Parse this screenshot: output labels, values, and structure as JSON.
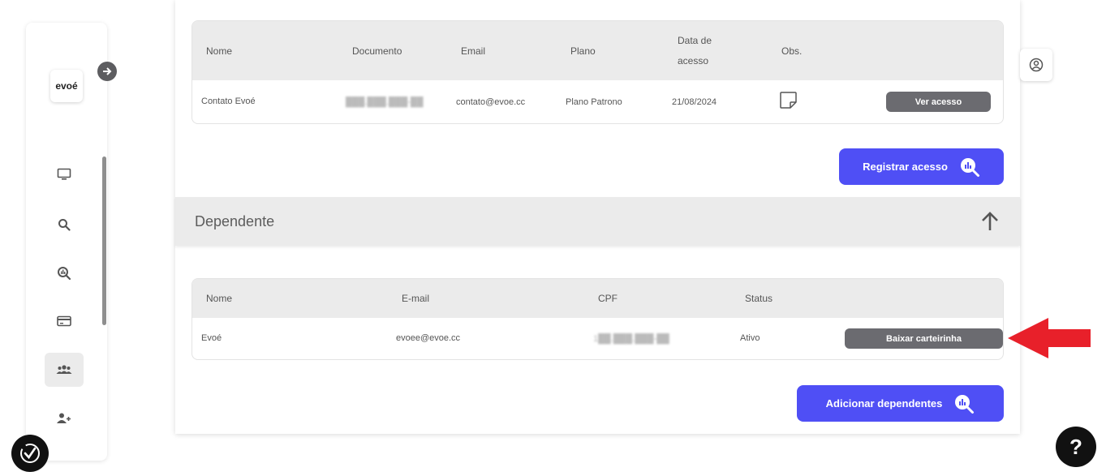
{
  "sidebar": {
    "logo_text": "evoé",
    "expand_icon": "arrow-right-circle-icon",
    "items": [
      {
        "icon": "monitor-icon"
      },
      {
        "icon": "search-icon"
      },
      {
        "icon": "search-chart-icon"
      },
      {
        "icon": "card-icon"
      },
      {
        "icon": "group-icon",
        "active": true
      },
      {
        "icon": "add-user-icon"
      }
    ]
  },
  "access_table": {
    "headers": {
      "nome": "Nome",
      "documento": "Documento",
      "email": "Email",
      "plano": "Plano",
      "data_acesso_line1": "Data de",
      "data_acesso_line2": "acesso",
      "obs": "Obs."
    },
    "row": {
      "nome": "Contato Evoé",
      "documento": "███.███.███-██",
      "email": "contato@evoe.cc",
      "plano": "Plano Patrono",
      "data": "21/08/2024",
      "obs_icon": "note-icon",
      "action": "Ver acesso"
    }
  },
  "register_button": {
    "label": "Registrar acesso",
    "icon": "search-chart-icon"
  },
  "dependents_section": {
    "title": "Dependente",
    "collapse_icon": "arrow-up-icon",
    "table": {
      "headers": {
        "nome": "Nome",
        "email": "E-mail",
        "cpf": "CPF",
        "status": "Status"
      },
      "row": {
        "nome": "Evoé",
        "email": "evoee@evoe.cc",
        "cpf": "1██.███.███-██",
        "status": "Ativo",
        "action": "Baixar carteirinha"
      }
    },
    "add_button": {
      "label": "Adicionar dependentes",
      "icon": "search-chart-icon"
    }
  },
  "profile_icon": "user-circle-icon",
  "help_label": "?",
  "accessibility_icon": "accessibility-check-icon",
  "colors": {
    "primary": "#4f4ff5",
    "pill": "#6b6b70",
    "arrow": "#e8202a",
    "header_bg": "#ebebeb"
  }
}
